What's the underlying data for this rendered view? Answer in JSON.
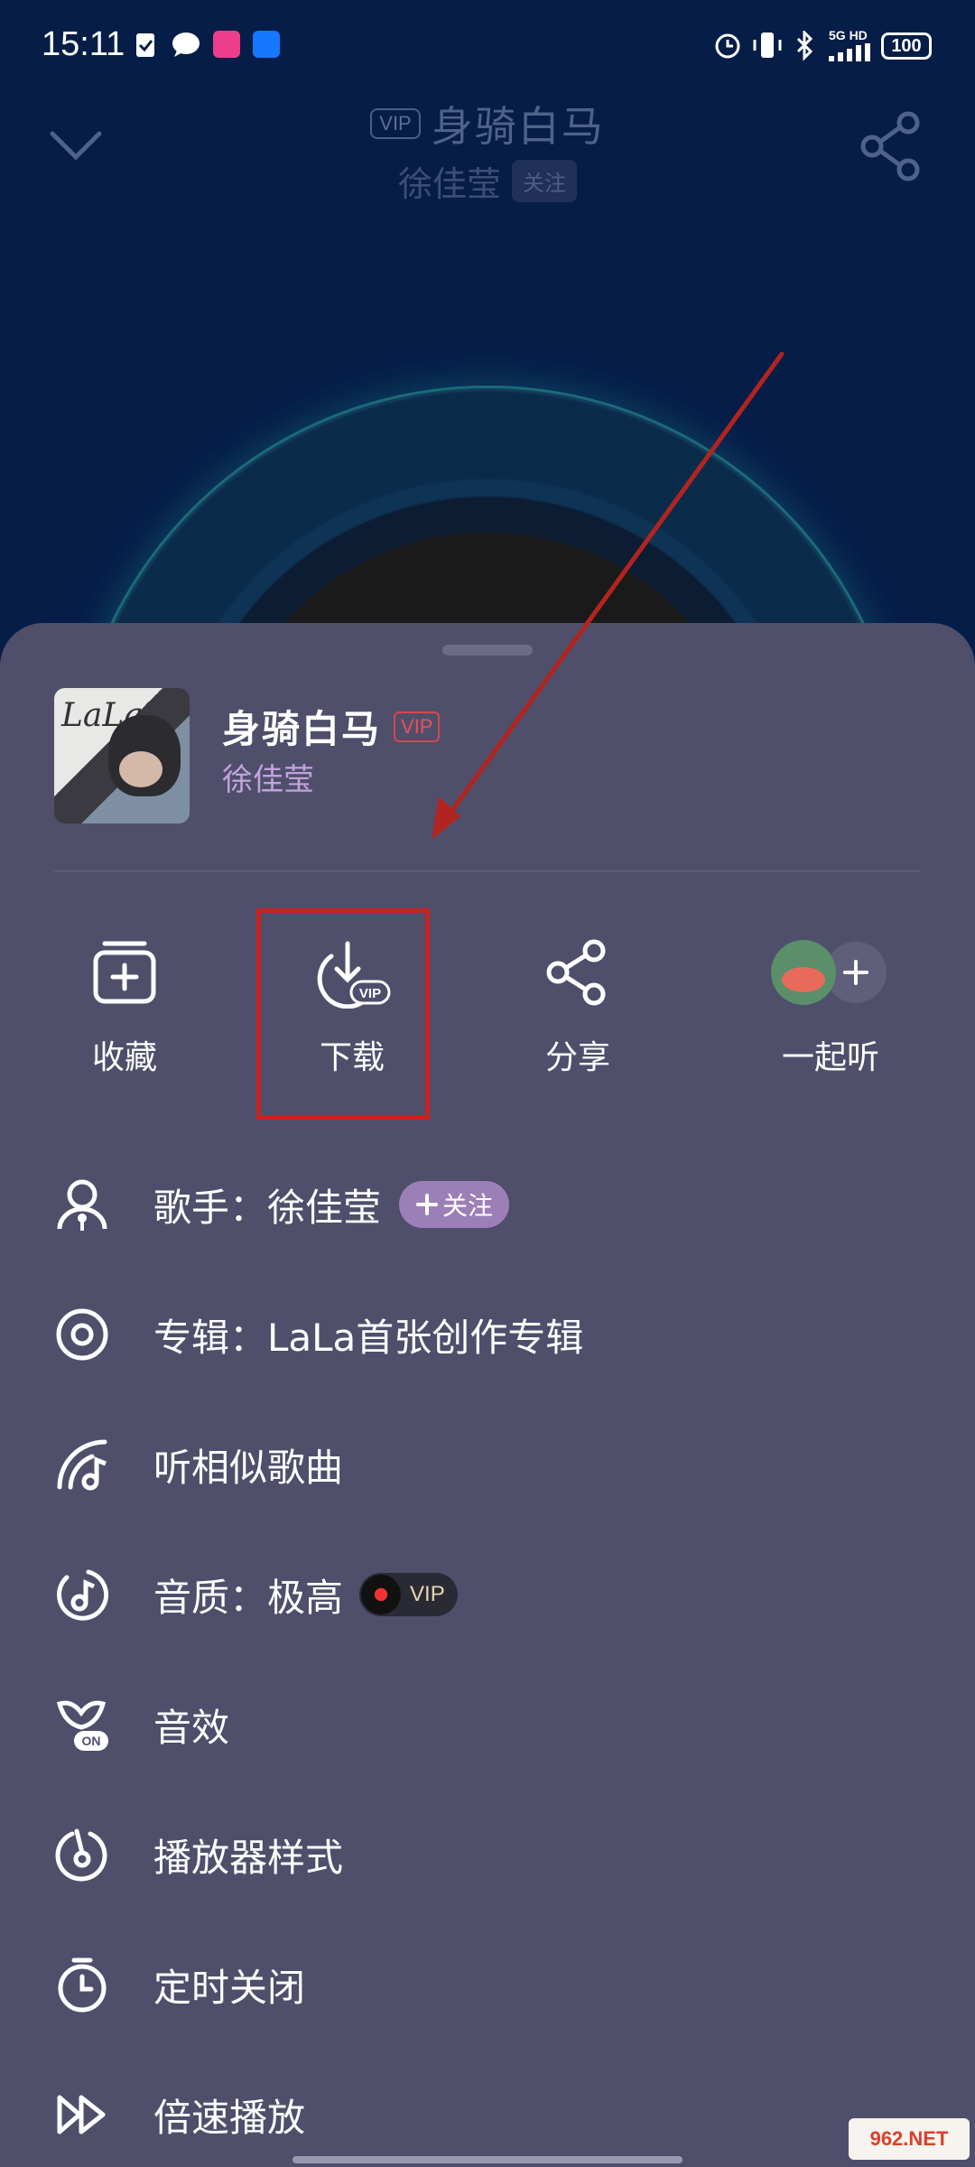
{
  "status_bar": {
    "time": "15:11",
    "network": "5G HD",
    "battery": "100"
  },
  "player_header": {
    "vip_tag": "VIP",
    "title": "身骑白马",
    "artist": "徐佳莹",
    "follow": "关注"
  },
  "sheet": {
    "song_title": "身骑白马",
    "vip_tag": "VIP",
    "artist": "徐佳莹",
    "cover_text": "LaLa",
    "actions": [
      {
        "label": "收藏",
        "icon": "add-to-collection-icon"
      },
      {
        "label": "下载",
        "icon": "download-vip-icon",
        "badge": "VIP"
      },
      {
        "label": "分享",
        "icon": "share-icon"
      },
      {
        "label": "一起听",
        "icon": "listen-together-icon"
      }
    ],
    "menu": [
      {
        "label": "歌手：徐佳莹",
        "icon": "singer-icon",
        "extra": "关注"
      },
      {
        "label": "专辑：LaLa首张创作专辑",
        "icon": "album-icon"
      },
      {
        "label": "听相似歌曲",
        "icon": "similar-songs-icon"
      },
      {
        "label": "音质：极高",
        "icon": "quality-icon",
        "extra": "VIP"
      },
      {
        "label": "音效",
        "icon": "sound-effect-icon",
        "badge": "ON"
      },
      {
        "label": "播放器样式",
        "icon": "player-style-icon"
      },
      {
        "label": "定时关闭",
        "icon": "timer-icon"
      },
      {
        "label": "倍速播放",
        "icon": "speed-icon"
      }
    ]
  },
  "watermark": "962.NET",
  "colors": {
    "background": "#061d48",
    "sheet": "#4f4f6b",
    "accent_purple": "#c2a3dd",
    "vip_red": "#e85158",
    "highlight": "#c8231f"
  }
}
